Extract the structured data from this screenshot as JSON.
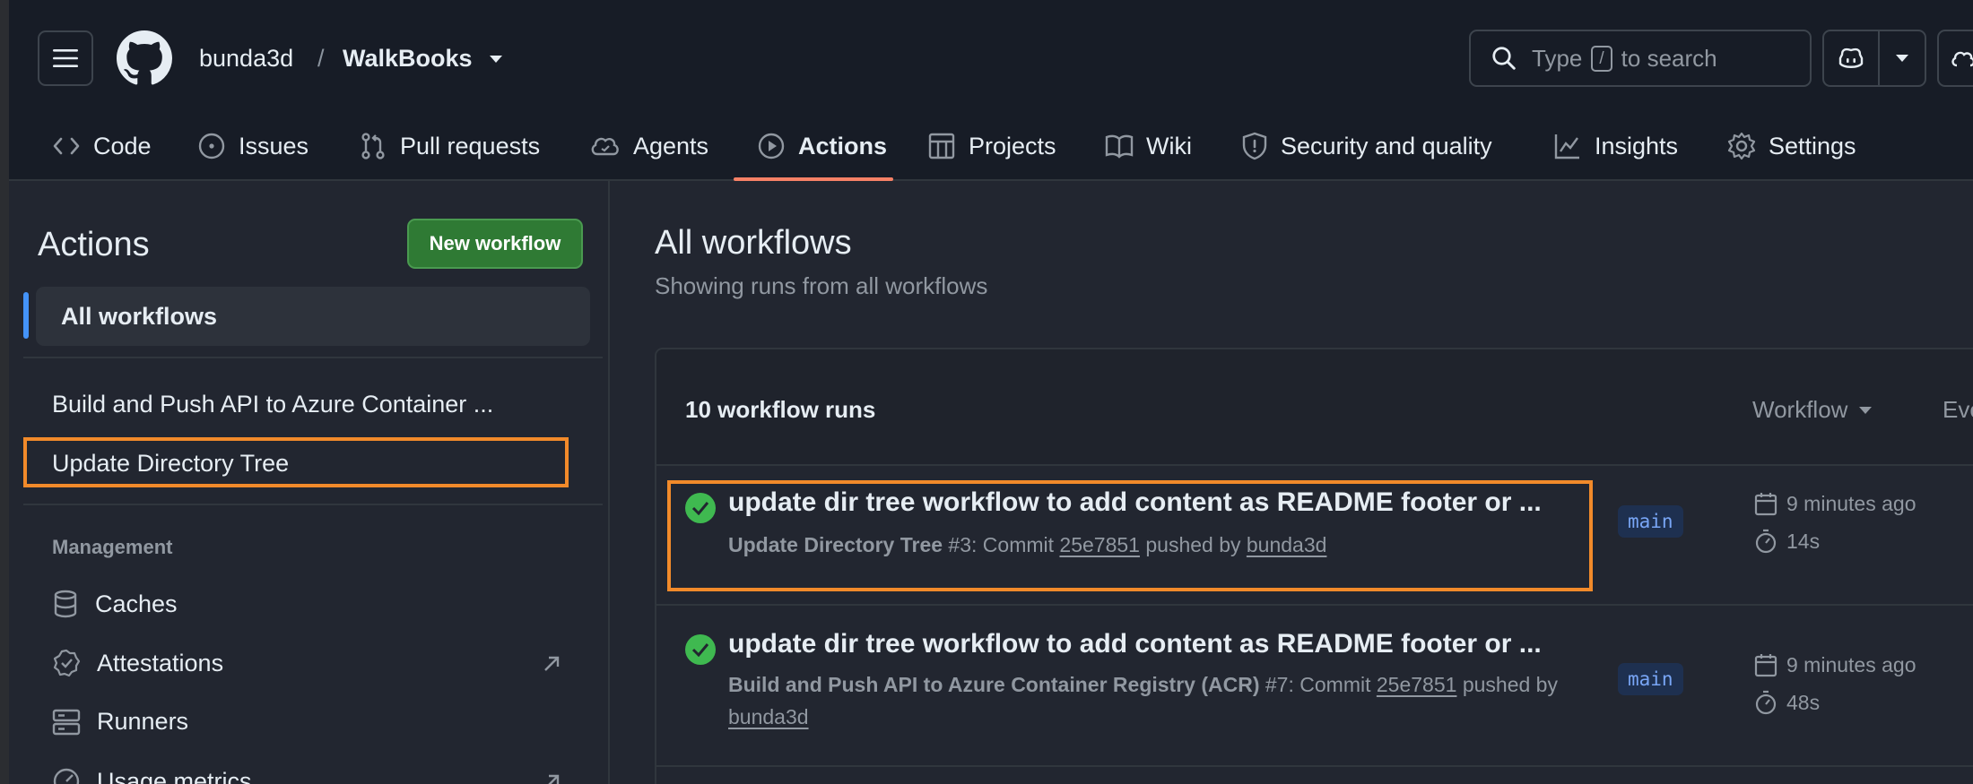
{
  "header": {
    "owner": "bunda3d",
    "separator": "/",
    "repo": "WalkBooks",
    "search": {
      "prefix": "Type",
      "key": "/",
      "suffix": "to search"
    }
  },
  "nav": {
    "tabs": [
      {
        "label": "Code",
        "icon": "code-icon"
      },
      {
        "label": "Issues",
        "icon": "issue-icon"
      },
      {
        "label": "Pull requests",
        "icon": "pull-request-icon"
      },
      {
        "label": "Agents",
        "icon": "agent-icon"
      },
      {
        "label": "Actions",
        "icon": "play-icon",
        "active": true
      },
      {
        "label": "Projects",
        "icon": "table-icon"
      },
      {
        "label": "Wiki",
        "icon": "book-icon"
      },
      {
        "label": "Security and quality",
        "icon": "shield-icon"
      },
      {
        "label": "Insights",
        "icon": "graph-icon"
      },
      {
        "label": "Settings",
        "icon": "gear-icon"
      }
    ]
  },
  "sidebar": {
    "title": "Actions",
    "new_workflow": "New workflow",
    "all_workflows": "All workflows",
    "workflows": [
      "Build and Push API to Azure Container ...",
      "Update Directory Tree"
    ],
    "management_label": "Management",
    "management": [
      {
        "label": "Caches",
        "icon": "database-icon"
      },
      {
        "label": "Attestations",
        "icon": "verified-icon"
      },
      {
        "label": "Runners",
        "icon": "server-icon"
      },
      {
        "label": "Usage metrics",
        "icon": "meter-icon"
      }
    ]
  },
  "main": {
    "title": "All workflows",
    "subtitle": "Showing runs from all workflows",
    "runs_count": "10 workflow runs",
    "filters": [
      "Workflow",
      "Eve"
    ],
    "runs": [
      {
        "title": "update dir tree workflow to add content as README footer or ...",
        "workflow": "Update Directory Tree",
        "number": "#3",
        "commit_label": "Commit",
        "commit": "25e7851",
        "pushed_by": "pushed by",
        "actor": "bunda3d",
        "branch": "main",
        "time": "9 minutes ago",
        "duration": "14s"
      },
      {
        "title": "update dir tree workflow to add content as README footer or ...",
        "workflow": "Build and Push API to Azure Container Registry (ACR)",
        "number": "#7",
        "commit_label": "Commit",
        "commit": "25e7851",
        "pushed_by": "pushed by",
        "actor": "bunda3d",
        "branch": "main",
        "time": "9 minutes ago",
        "duration": "48s"
      }
    ]
  },
  "colors": {
    "accent_green": "#2f7a34",
    "success": "#3fb950",
    "highlight": "#f28a2a",
    "active_tab": "#f78166"
  }
}
